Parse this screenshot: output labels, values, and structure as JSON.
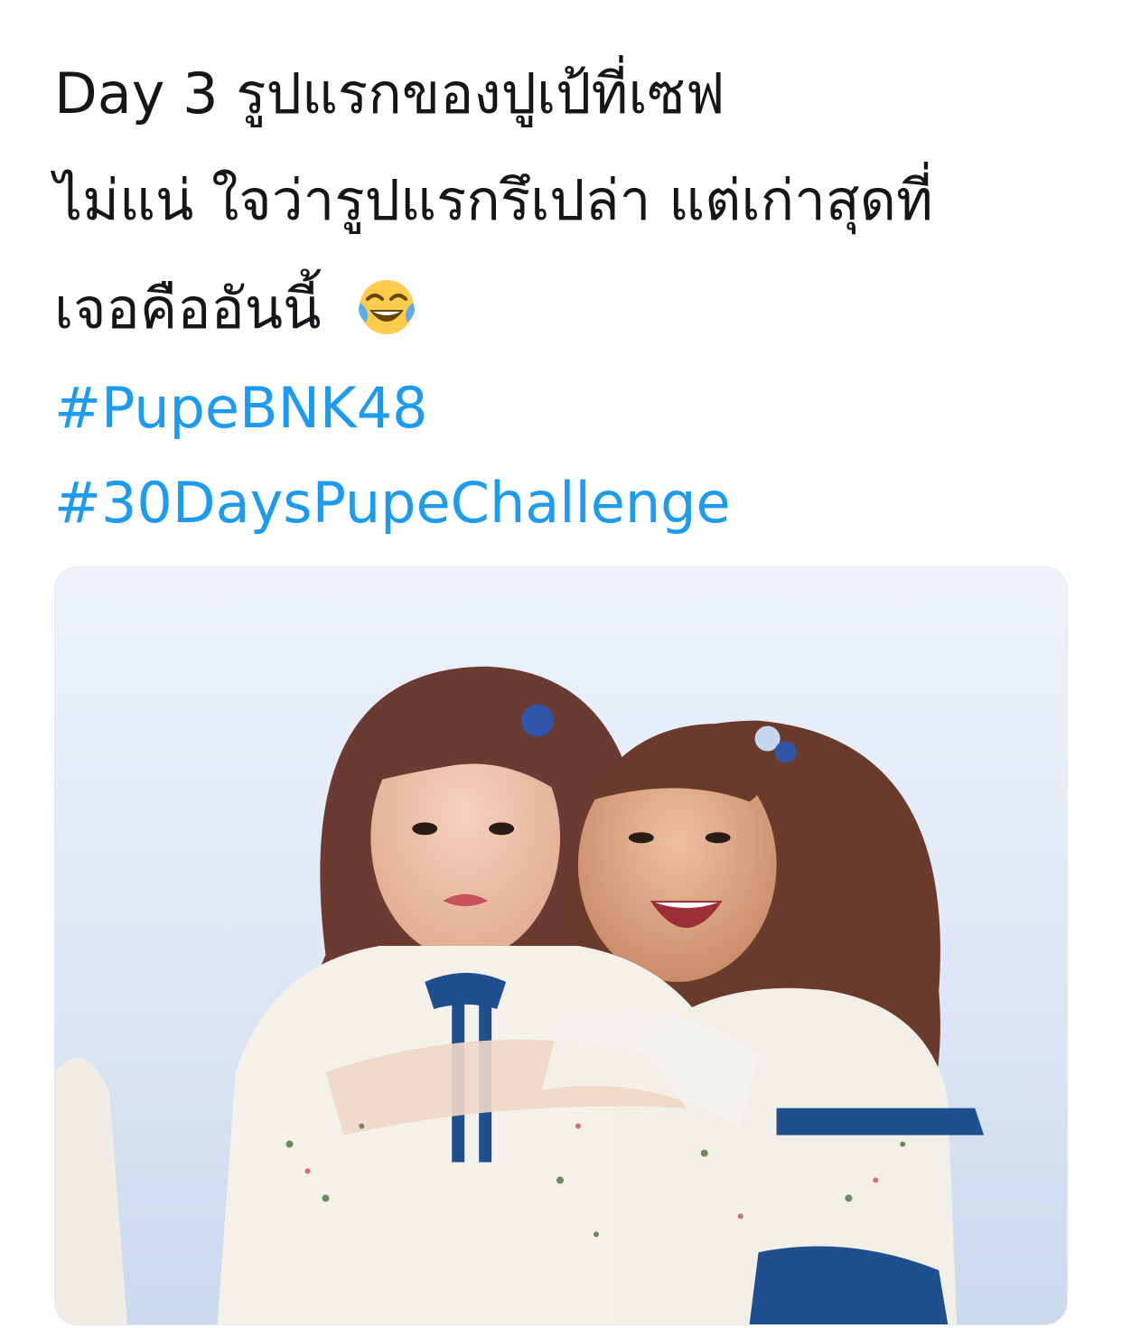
{
  "tweet": {
    "line1": "Day 3 รูปแรกของปูเป้ที่เซฟ",
    "line2": "ไม่แน่ ใจว่ารูปแรกรึเปล่า แต่เก่าสุดที่",
    "line3": "เจอคืออันนี้",
    "emoji": "face-with-tears-of-joy-icon",
    "hashtags": [
      "#PupeBNK48",
      "#30DaysPupeChallenge"
    ]
  },
  "media": {
    "type": "photo"
  },
  "colors": {
    "link": "#1d9bf0",
    "text": "#14171a",
    "background": "#ffffff"
  }
}
